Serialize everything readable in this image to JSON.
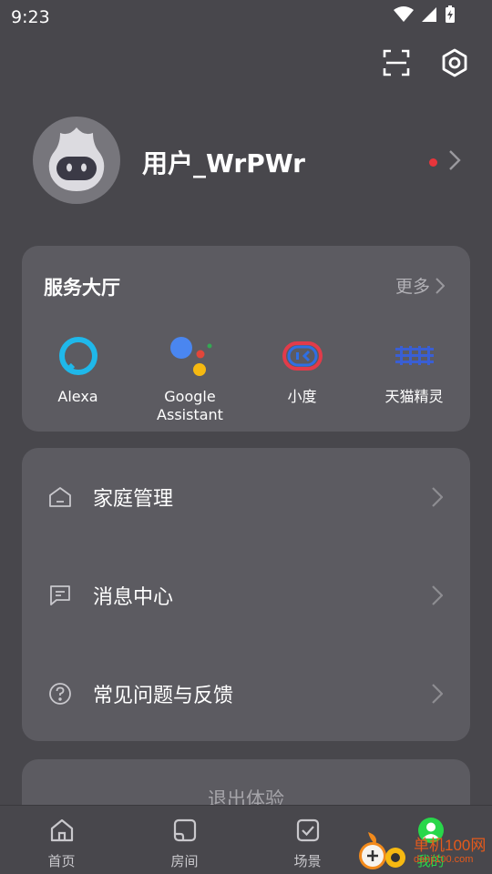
{
  "status_bar": {
    "time": "9:23"
  },
  "top_actions": {
    "scan": "scan-icon",
    "settings": "settings-icon"
  },
  "profile": {
    "username": "用户_WrPWr",
    "notification_dot_color": "#e8353b"
  },
  "services": {
    "title": "服务大厅",
    "more_label": "更多",
    "items": [
      {
        "label": "Alexa",
        "icon": "alexa-icon"
      },
      {
        "label": "Google\nAssistant",
        "icon": "google-assistant-icon"
      },
      {
        "label": "小度",
        "icon": "xiaodu-icon"
      },
      {
        "label": "天猫精灵",
        "icon": "tmall-genie-icon"
      }
    ]
  },
  "menu": {
    "items": [
      {
        "label": "家庭管理",
        "icon": "home-icon"
      },
      {
        "label": "消息中心",
        "icon": "message-icon"
      },
      {
        "label": "常见问题与反馈",
        "icon": "help-icon"
      }
    ]
  },
  "logout": {
    "label": "退出体验"
  },
  "tabbar": {
    "items": [
      {
        "label": "首页",
        "icon": "home-tab-icon"
      },
      {
        "label": "房间",
        "icon": "room-tab-icon"
      },
      {
        "label": "场景",
        "icon": "scene-tab-icon"
      },
      {
        "label": "我的",
        "icon": "profile-tab-icon",
        "active": true
      }
    ],
    "active_color": "#28d74a"
  },
  "watermark": {
    "text": "单机100网",
    "url_text": "danji100.com"
  }
}
